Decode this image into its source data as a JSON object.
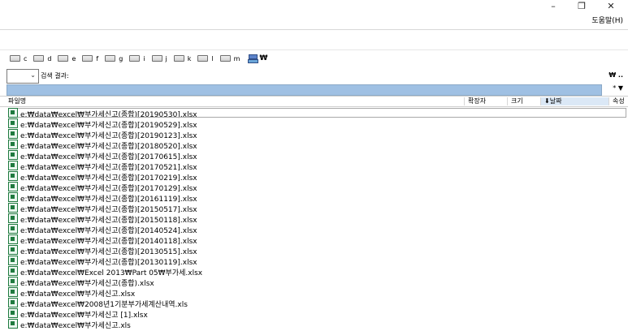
{
  "titlebar": {
    "minimize": "–",
    "restore": "❐",
    "close": "✕",
    "help_menu": "도움말(H)"
  },
  "drives": {
    "items": [
      "c",
      "d",
      "e",
      "f",
      "g",
      "i",
      "j",
      "k",
      "l",
      "m"
    ],
    "root": "₩"
  },
  "search": {
    "label": "검색 결과:",
    "selected": ""
  },
  "right_controls": {
    "top": "₩ ..",
    "filter": "* ▼"
  },
  "columns": {
    "marker": "",
    "name": "파일명",
    "ext": "확장자",
    "size": "크기",
    "date": "⬇날짜",
    "attr": "속성"
  },
  "files": [
    "e:₩data₩excel₩부가세신고(종합)[20190530].xlsx",
    "e:₩data₩excel₩부가세신고(종합)[20190529].xlsx",
    "e:₩data₩excel₩부가세신고(종합)[20190123].xlsx",
    "e:₩data₩excel₩부가세신고(종합)[20180520].xlsx",
    "e:₩data₩excel₩부가세신고(종합)[20170615].xlsx",
    "e:₩data₩excel₩부가세신고(종합)[20170521].xlsx",
    "e:₩data₩excel₩부가세신고(종합)[20170219].xlsx",
    "e:₩data₩excel₩부가세신고(종합)[20170129].xlsx",
    "e:₩data₩excel₩부가세신고(종합)[20161119].xlsx",
    "e:₩data₩excel₩부가세신고(종합)[20150517].xlsx",
    "e:₩data₩excel₩부가세신고(종합)[20150118].xlsx",
    "e:₩data₩excel₩부가세신고(종합)[20140524].xlsx",
    "e:₩data₩excel₩부가세신고(종합)[20140118].xlsx",
    "e:₩data₩excel₩부가세신고(종합)[20130515].xlsx",
    "e:₩data₩excel₩부가세신고(종합)[20130119].xlsx",
    "e:₩data₩excel₩Excel 2013₩Part 05₩부가세.xlsx",
    "e:₩data₩excel₩부가세신고(종합).xlsx",
    "e:₩data₩excel₩부가세신고.xlsx",
    "e:₩data₩excel₩2008년1기분부가세계산내역.xls",
    "e:₩data₩excel₩부가세신고 [1].xlsx",
    "e:₩data₩excel₩부가세신고.xls"
  ]
}
